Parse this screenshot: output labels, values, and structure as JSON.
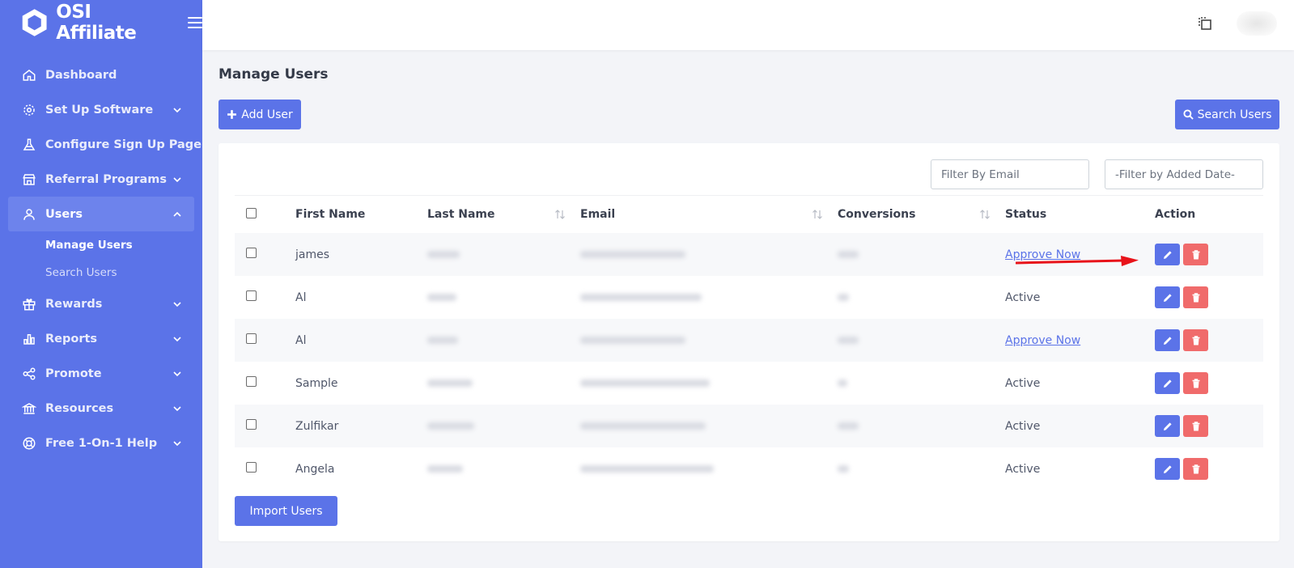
{
  "app": {
    "brand_name": "OSI Affiliate",
    "brand_color": "#5b73e8"
  },
  "sidebar": {
    "items": [
      {
        "label": "Dashboard",
        "icon": "home-icon"
      },
      {
        "label": "Set Up Software",
        "icon": "gear-icon"
      },
      {
        "label": "Configure Sign Up Page",
        "icon": "flask-icon"
      },
      {
        "label": "Referral Programs",
        "icon": "store-icon"
      },
      {
        "label": "Users",
        "icon": "user-icon"
      },
      {
        "label": "Rewards",
        "icon": "gift-icon"
      },
      {
        "label": "Reports",
        "icon": "bar-chart-icon"
      },
      {
        "label": "Promote",
        "icon": "share-icon"
      },
      {
        "label": "Resources",
        "icon": "bank-icon"
      },
      {
        "label": "Free 1-On-1 Help",
        "icon": "lifebuoy-icon"
      }
    ],
    "users_sub": [
      {
        "label": "Manage Users"
      },
      {
        "label": "Search Users"
      }
    ]
  },
  "page": {
    "title": "Manage Users",
    "add_user_label": "Add User",
    "search_users_label": "Search Users",
    "import_users_label": "Import Users"
  },
  "filters": {
    "email_placeholder": "Filter By Email",
    "date_placeholder": "-Filter by Added Date-"
  },
  "table": {
    "headers": {
      "first_name": "First Name",
      "last_name": "Last Name",
      "email": "Email",
      "conversions": "Conversions",
      "status": "Status",
      "action": "Action"
    },
    "rows": [
      {
        "first_name": "james",
        "status": "Approve Now"
      },
      {
        "first_name": "Al",
        "status": "Active"
      },
      {
        "first_name": "Al",
        "status": "Approve Now"
      },
      {
        "first_name": "Sample",
        "status": "Active"
      },
      {
        "first_name": "Zulfikar",
        "status": "Active"
      },
      {
        "first_name": "Angela",
        "status": "Active"
      }
    ]
  },
  "colors": {
    "primary": "#5b73e8",
    "danger": "#f06b6b",
    "arrow": "#e8131a"
  }
}
